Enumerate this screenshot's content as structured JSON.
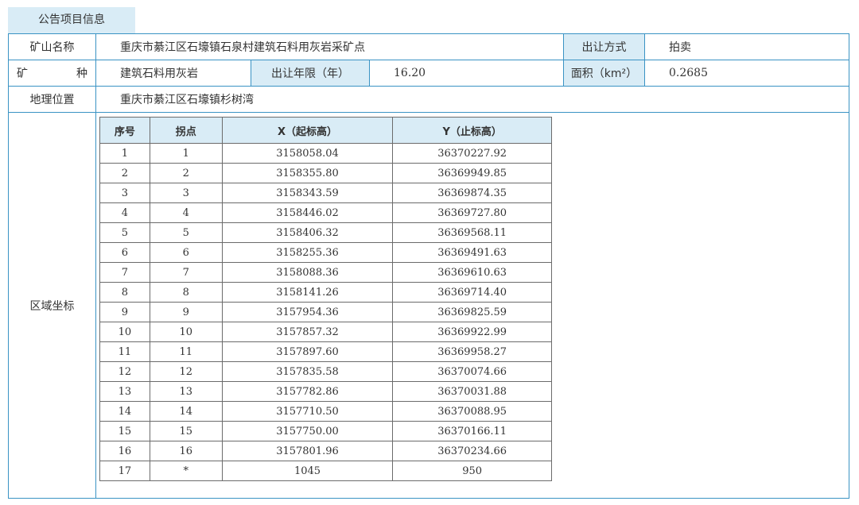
{
  "tab_label": "公告项目信息",
  "info": {
    "mine_name_label": "矿山名称",
    "mine_name_value": "重庆市綦江区石壕镇石泉村建筑石料用灰岩采矿点",
    "transfer_method_label": "出让方式",
    "transfer_method_value": "拍卖",
    "mineral_label_a": "矿",
    "mineral_label_b": "种",
    "mineral_value": "建筑石料用灰岩",
    "term_label": "出让年限（年）",
    "term_value": "16.20",
    "area_label": "面积（km²）",
    "area_value": "0.2685",
    "location_label": "地理位置",
    "location_value": "重庆市綦江区石壕镇杉树湾",
    "coords_label": "区域坐标"
  },
  "coords_table": {
    "headers": [
      "序号",
      "拐点",
      "X（起标高）",
      "Y（止标高）"
    ],
    "rows": [
      [
        "1",
        "1",
        "3158058.04",
        "36370227.92"
      ],
      [
        "2",
        "2",
        "3158355.80",
        "36369949.85"
      ],
      [
        "3",
        "3",
        "3158343.59",
        "36369874.35"
      ],
      [
        "4",
        "4",
        "3158446.02",
        "36369727.80"
      ],
      [
        "5",
        "5",
        "3158406.32",
        "36369568.11"
      ],
      [
        "6",
        "6",
        "3158255.36",
        "36369491.63"
      ],
      [
        "7",
        "7",
        "3158088.36",
        "36369610.63"
      ],
      [
        "8",
        "8",
        "3158141.26",
        "36369714.40"
      ],
      [
        "9",
        "9",
        "3157954.36",
        "36369825.59"
      ],
      [
        "10",
        "10",
        "3157857.32",
        "36369922.99"
      ],
      [
        "11",
        "11",
        "3157897.60",
        "36369958.27"
      ],
      [
        "12",
        "12",
        "3157835.58",
        "36370074.66"
      ],
      [
        "13",
        "13",
        "3157782.86",
        "36370031.88"
      ],
      [
        "14",
        "14",
        "3157710.50",
        "36370088.95"
      ],
      [
        "15",
        "15",
        "3157750.00",
        "36370166.11"
      ],
      [
        "16",
        "16",
        "3157801.96",
        "36370234.66"
      ],
      [
        "17",
        "*",
        "1045",
        "950"
      ]
    ]
  }
}
